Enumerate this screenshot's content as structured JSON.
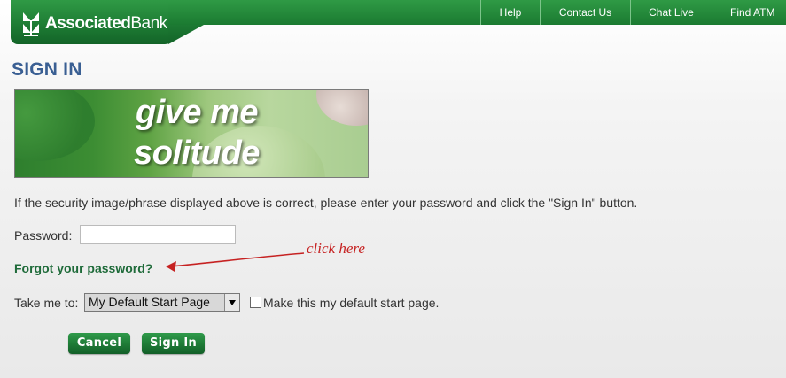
{
  "header": {
    "brand": {
      "bold": "Associated",
      "light": "Bank"
    },
    "nav": [
      "Help",
      "Contact Us",
      "Chat Live",
      "Find ATM"
    ]
  },
  "page_title": "SIGN IN",
  "security_image": {
    "phrase_line1": "give me",
    "phrase_line2": "solitude"
  },
  "instructions": "If the security image/phrase displayed above is correct, please enter your password and click the \"Sign In\" button.",
  "password": {
    "label": "Password:",
    "value": ""
  },
  "forgot_link": "Forgot your password?",
  "annotation": "click here",
  "start_page": {
    "label": "Take me to:",
    "selected": "My Default Start Page",
    "checkbox_label": "Make this my default start page.",
    "checked": false
  },
  "buttons": {
    "cancel": "Cancel",
    "sign_in": "Sign In"
  },
  "colors": {
    "brand_green": "#1d7a33",
    "title_blue": "#3a5f93",
    "link_green": "#1f6b3a",
    "annotation_red": "#c62222"
  }
}
